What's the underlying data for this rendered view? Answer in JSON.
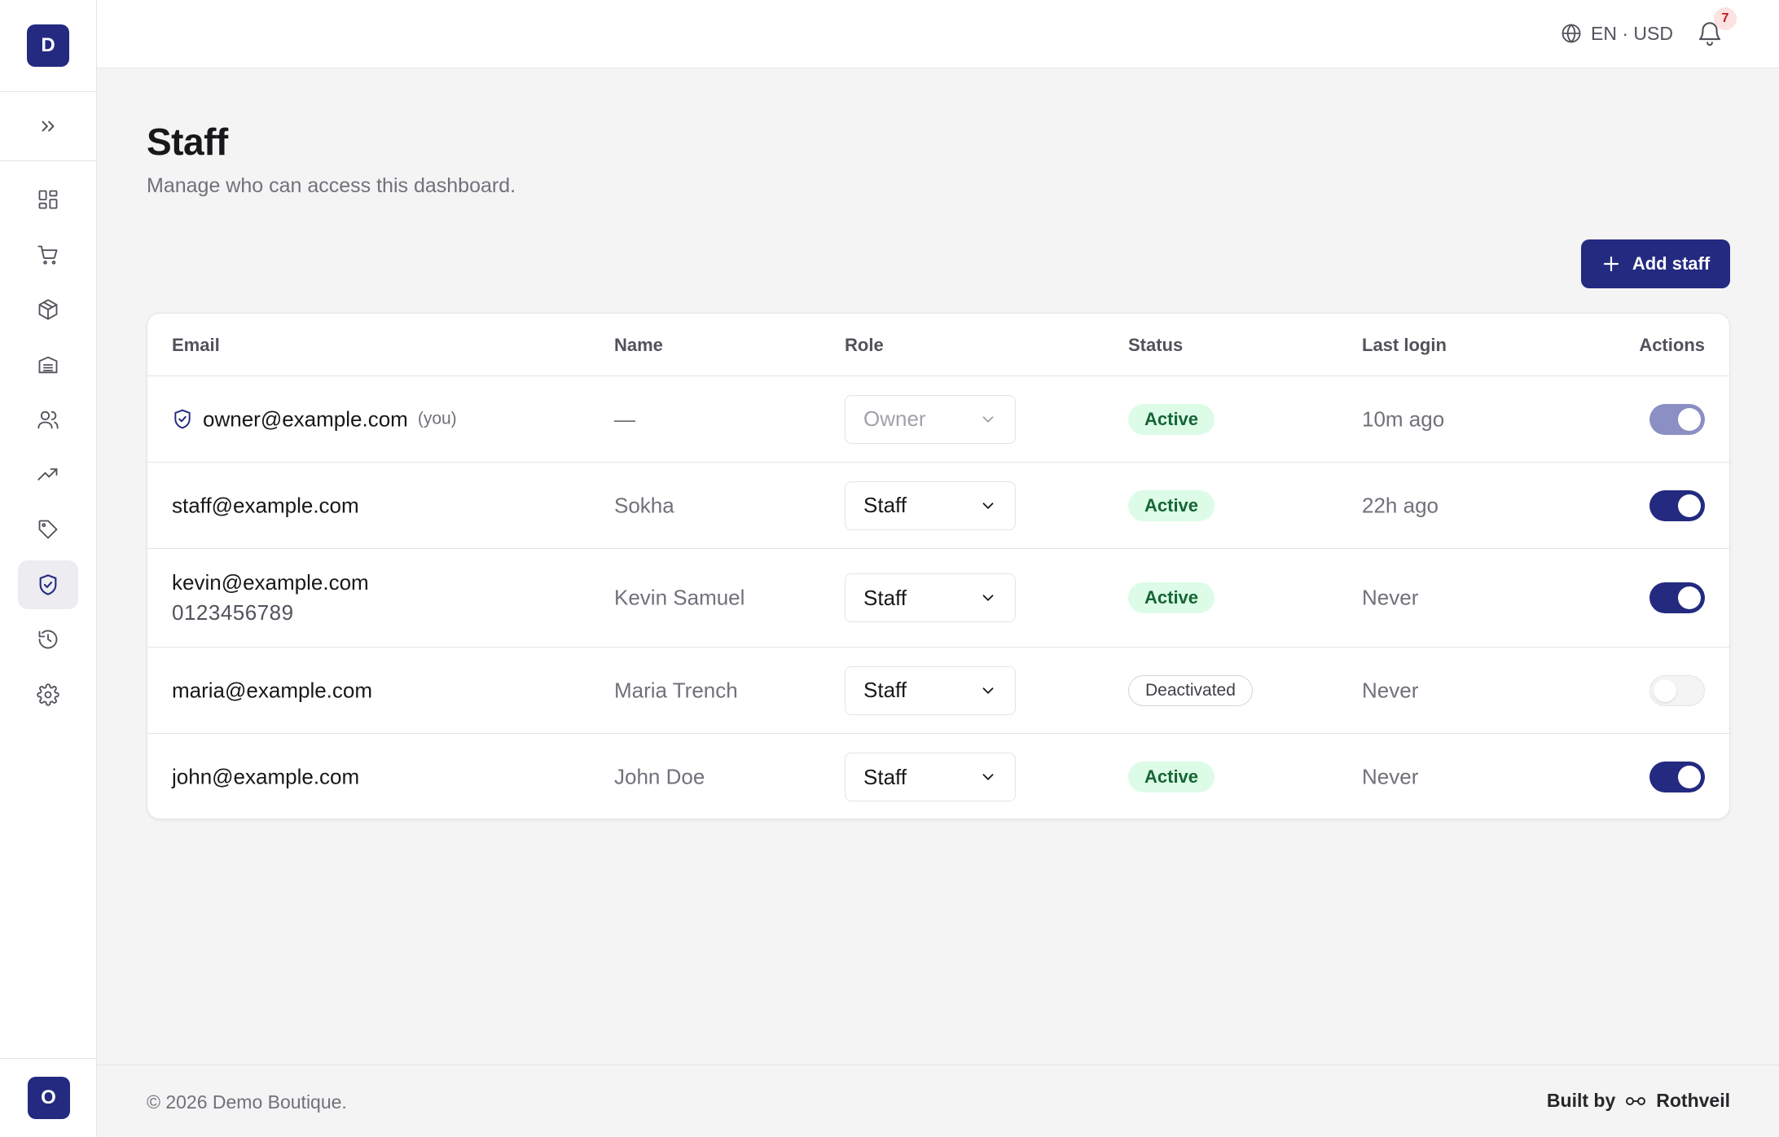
{
  "brand": {
    "initial": "D"
  },
  "user": {
    "initial": "O"
  },
  "sidebar": {
    "items": [
      {
        "icon": "dashboard-icon"
      },
      {
        "icon": "cart-icon"
      },
      {
        "icon": "box-icon"
      },
      {
        "icon": "archive-icon"
      },
      {
        "icon": "users-icon"
      },
      {
        "icon": "trending-icon"
      },
      {
        "icon": "tag-icon"
      },
      {
        "icon": "shield-icon",
        "active": true
      },
      {
        "icon": "history-icon"
      },
      {
        "icon": "gear-icon"
      }
    ]
  },
  "topbar": {
    "locale": "EN · USD",
    "notifications": "7"
  },
  "page": {
    "title": "Staff",
    "subtitle": "Manage who can access this dashboard.",
    "add_button": "Add staff"
  },
  "table": {
    "headers": {
      "email": "Email",
      "name": "Name",
      "role": "Role",
      "status": "Status",
      "last_login": "Last login",
      "actions": "Actions"
    },
    "rows": [
      {
        "email": "owner@example.com",
        "you": "(you)",
        "name": "—",
        "role": "Owner",
        "status": "Active",
        "last_login": "10m ago"
      },
      {
        "email": "staff@example.com",
        "name": "Sokha",
        "role": "Staff",
        "status": "Active",
        "last_login": "22h ago"
      },
      {
        "email": "kevin@example.com",
        "phone": "0123456789",
        "name": "Kevin Samuel",
        "role": "Staff",
        "status": "Active",
        "last_login": "Never"
      },
      {
        "email": "maria@example.com",
        "name": "Maria Trench",
        "role": "Staff",
        "status": "Deactivated",
        "last_login": "Never"
      },
      {
        "email": "john@example.com",
        "name": "John Doe",
        "role": "Staff",
        "status": "Active",
        "last_login": "Never"
      }
    ]
  },
  "footer": {
    "copyright": "© 2026 Demo Boutique.",
    "built_by": "Built by",
    "vendor": "Rothveil"
  },
  "colors": {
    "accent": "#232a80",
    "active_bg": "#dcfce7",
    "active_text": "#166534"
  }
}
